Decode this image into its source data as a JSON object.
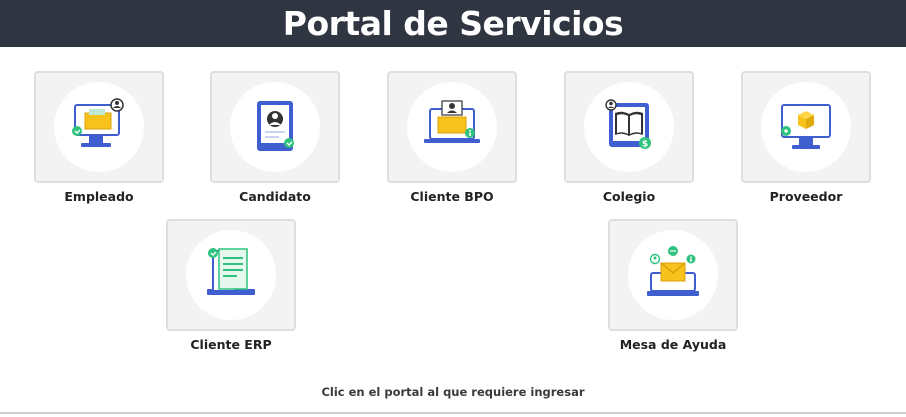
{
  "header": {
    "title": "Portal de Servicios"
  },
  "portals": [
    {
      "id": "empleado",
      "label": "Empleado",
      "icon": "employee-monitor-icon"
    },
    {
      "id": "candidato",
      "label": "Candidato",
      "icon": "candidate-tablet-icon"
    },
    {
      "id": "cliente-bpo",
      "label": "Cliente BPO",
      "icon": "client-bpo-laptop-icon"
    },
    {
      "id": "colegio",
      "label": "Colegio",
      "icon": "school-book-tablet-icon"
    },
    {
      "id": "proveedor",
      "label": "Proveedor",
      "icon": "supplier-box-monitor-icon"
    },
    {
      "id": "cliente-erp",
      "label": "Cliente ERP",
      "icon": "client-erp-document-icon"
    },
    {
      "id": "mesa-de-ayuda",
      "label": "Mesa de Ayuda",
      "icon": "help-desk-mail-icon"
    }
  ],
  "footer": {
    "hint": "Clic en el portal al que requiere ingresar"
  },
  "colors": {
    "header_bg": "#2f3541",
    "accent_blue": "#3f5fd1",
    "accent_yellow": "#f7c21b",
    "accent_green": "#2ec27e",
    "tile_bg": "#f3f3f3"
  }
}
